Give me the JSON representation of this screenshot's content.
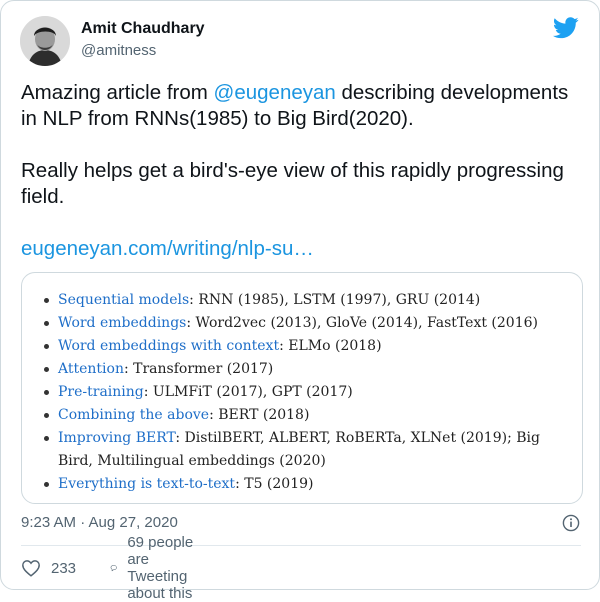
{
  "author": {
    "name": "Amit Chaudhary",
    "handle": "@amitness"
  },
  "tweet": {
    "line1_prefix": "Amazing article from ",
    "mention": "@eugeneyan",
    "line1_suffix": " describing developments in NLP from RNNs(1985) to Big Bird(2020).",
    "line2": "Really helps get a bird's-eye view of this rapidly progressing field.",
    "link": "eugeneyan.com/writing/nlp-su…"
  },
  "media": {
    "items": [
      {
        "term": "Sequential models",
        "rest": ": RNN (1985), LSTM (1997), GRU (2014)"
      },
      {
        "term": "Word embeddings",
        "rest": ": Word2vec (2013), GloVe (2014), FastText (2016)"
      },
      {
        "term": "Word embeddings with context",
        "rest": ": ELMo (2018)"
      },
      {
        "term": "Attention",
        "rest": ": Transformer (2017)"
      },
      {
        "term": "Pre-training",
        "rest": ": ULMFiT (2017), GPT (2017)"
      },
      {
        "term": "Combining the above",
        "rest": ": BERT (2018)"
      },
      {
        "term": "Improving BERT",
        "rest": ": DistilBERT, ALBERT, RoBERTa, XLNet (2019); Big Bird, Multilingual embeddings (2020)"
      },
      {
        "term": "Everything is text-to-text",
        "rest": ": T5 (2019)"
      }
    ]
  },
  "meta": {
    "timestamp": "9:23 AM · Aug 27, 2020"
  },
  "actions": {
    "likes": "233",
    "conversation": "69 people are Tweeting about this"
  },
  "colors": {
    "link": "#1b95e0",
    "twitter_blue": "#1da1f2",
    "muted": "#536471"
  }
}
